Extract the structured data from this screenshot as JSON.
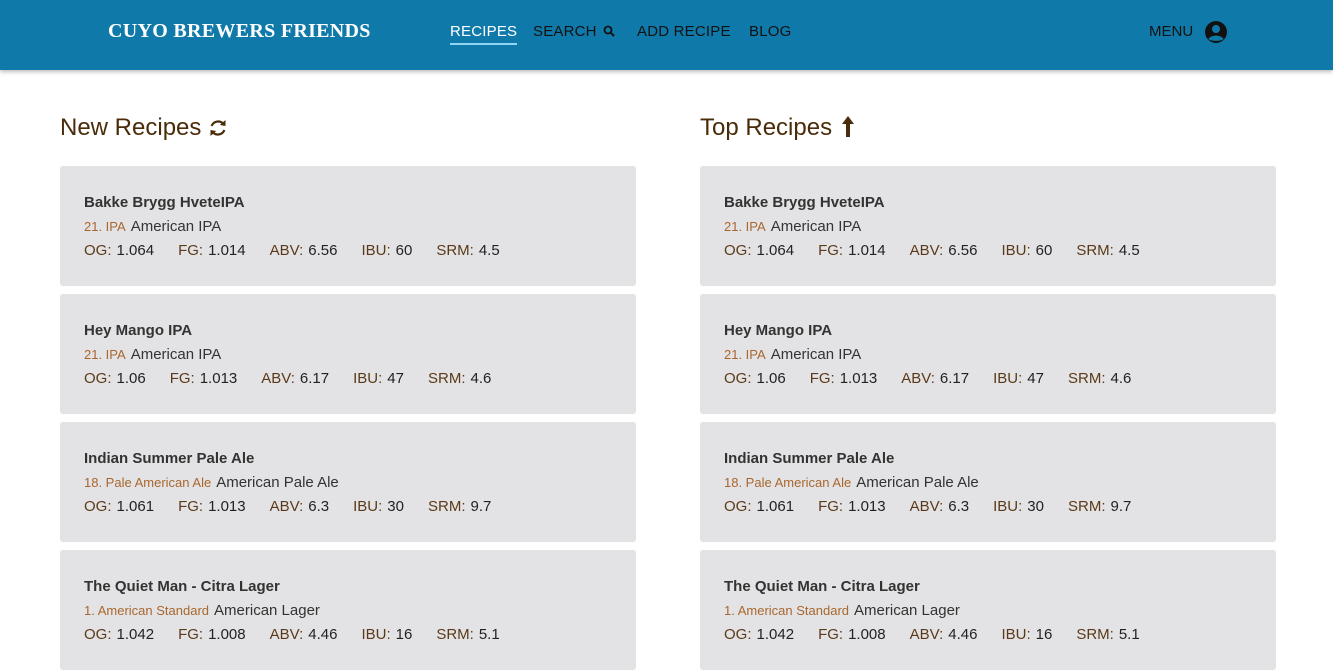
{
  "header": {
    "brand": "CUYO BREWERS FRIENDS",
    "nav": [
      {
        "label": "RECIPES"
      },
      {
        "label": "SEARCH"
      },
      {
        "label": "ADD RECIPE"
      },
      {
        "label": "BLOG"
      }
    ],
    "menu_label": "MENU"
  },
  "sections": {
    "new": {
      "title": "New Recipes",
      "icon": "refresh-icon"
    },
    "top": {
      "title": "Top Recipes",
      "icon": "arrow-up-icon"
    }
  },
  "stat_labels": {
    "og": "OG:",
    "fg": "FG:",
    "abv": "ABV:",
    "ibu": "IBU:",
    "srm": "SRM:"
  },
  "recipes": [
    {
      "name": "Bakke Brygg HveteIPA",
      "style_code": "21. IPA",
      "style": "American IPA",
      "og": "1.064",
      "fg": "1.014",
      "abv": "6.56",
      "ibu": "60",
      "srm": "4.5"
    },
    {
      "name": "Hey Mango IPA",
      "style_code": "21. IPA",
      "style": "American IPA",
      "og": "1.06",
      "fg": "1.013",
      "abv": "6.17",
      "ibu": "47",
      "srm": "4.6"
    },
    {
      "name": "Indian Summer Pale Ale",
      "style_code": "18. Pale American Ale",
      "style": "American Pale Ale",
      "og": "1.061",
      "fg": "1.013",
      "abv": "6.3",
      "ibu": "30",
      "srm": "9.7"
    },
    {
      "name": "The Quiet Man - Citra Lager",
      "style_code": "1. American Standard",
      "style": "American Lager",
      "og": "1.042",
      "fg": "1.008",
      "abv": "4.46",
      "ibu": "16",
      "srm": "5.1"
    }
  ],
  "colors": {
    "header_bg": "#0f7aa9",
    "card_bg": "#e3e3e5",
    "title": "#4a2c0a",
    "style_code": "#a9672e"
  }
}
